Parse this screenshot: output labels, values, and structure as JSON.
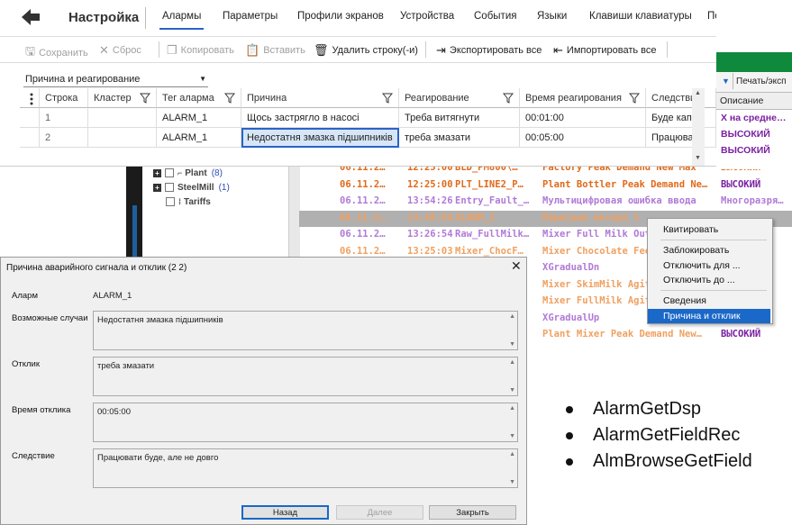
{
  "settings": {
    "title": "Настройка",
    "tabs": [
      "Алармы",
      "Параметры",
      "Профили экранов",
      "Устройства",
      "События",
      "Языки",
      "Клавиши клавиатуры",
      "Пс"
    ],
    "active_tab": 0,
    "toolbar": {
      "save": "Сохранить",
      "reset": "Сброс",
      "copy": "Копировать",
      "paste": "Вставить",
      "delete_row": "Удалить строку(-и)",
      "export_all": "Экспортировать все",
      "import_all": "Импортировать все"
    },
    "filter_label": "Причина и реагирование",
    "grid": {
      "headers": [
        "Строка",
        "Кластер",
        "Тег аларма",
        "Причина",
        "Реагирование",
        "Время реагирования",
        "Следстви"
      ],
      "rows": [
        {
          "row": "1",
          "cluster": "",
          "tag": "ALARM_1",
          "cause": "Щось застрягло в насосі",
          "response": "Треба витягнути",
          "time": "00:01:00",
          "effect": "Буде капе"
        },
        {
          "row": "2",
          "cluster": "",
          "tag": "ALARM_1",
          "cause": "Недостатня змазка підшипників",
          "response": "треба змазати",
          "time": "00:05:00",
          "effect": "Працюват"
        }
      ]
    }
  },
  "alarm_list": {
    "tree": [
      {
        "label": "Plant",
        "count": "(8)"
      },
      {
        "label": "SteelMill",
        "count": "(1)"
      },
      {
        "label": "Tariffs",
        "count": ""
      }
    ],
    "print_label": "Печать/эксп",
    "desc_header": "Описание",
    "right_cells": [
      {
        "text": "Х на средне…",
        "color": "#7a1fa2"
      },
      {
        "text": "ВЫСОКИЙ",
        "color": "#7a1fa2"
      },
      {
        "text": "ВЫСОКИЙ",
        "color": "#7a1fa2"
      }
    ],
    "rows": [
      {
        "date": "06.11.2…",
        "time": "12:25:00",
        "tag": "BLD_PM800\\…",
        "desc": "Factory Peak Demand New Max",
        "prio": "ВЫСОКИЙ",
        "color": "#e06a1a"
      },
      {
        "date": "06.11.2…",
        "time": "12:25:00",
        "tag": "PLT_LINE2_P…",
        "desc": "Plant Bottler Peak Demand Ne…",
        "prio": "ВЫСОКИЙ",
        "color": "#e06a1a"
      },
      {
        "date": "06.11.2…",
        "time": "13:54:26",
        "tag": "Entry_Fault_…",
        "desc": "Мультицифровая ошибка ввода",
        "prio": "Многоразря…",
        "color": "#b07ad6"
      },
      {
        "date": "06.11.2…",
        "time": "13:49:54",
        "tag": "ALARM_1",
        "desc": "Перегрев мотора 1",
        "prio": "",
        "color": "#f0a060"
      },
      {
        "date": "06.11.2…",
        "time": "13:26:54",
        "tag": "Raw_FullMilk…",
        "desc": "Mixer Full Milk Out P…",
        "prio": "",
        "color": "#b07ad6"
      },
      {
        "date": "06.11.2…",
        "time": "13:25:03",
        "tag": "Mixer_ChocF…",
        "desc": "Mixer Chocolate Feed",
        "prio": "",
        "color": "#f0a060"
      },
      {
        "date": "",
        "time": "",
        "tag": "",
        "desc": "XGradualDn",
        "prio": "",
        "color": "#b07ad6"
      },
      {
        "date": "",
        "time": "",
        "tag": "",
        "desc": "Mixer SkimMilk Agitat",
        "prio": "",
        "color": "#f0a060"
      },
      {
        "date": "",
        "time": "",
        "tag": "",
        "desc": "Mixer FullMilk Agitato",
        "prio": "",
        "color": "#f0a060"
      },
      {
        "date": "",
        "time": "",
        "tag": "",
        "desc": "XGradualUp",
        "prio": "",
        "color": "#b07ad6"
      },
      {
        "date": "",
        "time": "",
        "tag": "",
        "desc": "Plant Mixer Peak Demand New…",
        "prio": "ВЫСОКИЙ",
        "color": "#f0a060"
      }
    ]
  },
  "context_menu": {
    "items": [
      "Квитировать",
      "Заблокировать",
      "Отключить для ...",
      "Отключить до ...",
      "Сведения",
      "Причина и отклик"
    ],
    "highlighted": 5
  },
  "dialog": {
    "title": "Причина аварийного сигнала и отклик (2  2)",
    "alarm_label": "Аларм",
    "alarm_value": "ALARM_1",
    "cause_label": "Возможные случаи",
    "cause_value": "Недостатня змазка підшипників",
    "response_label": "Отклик",
    "response_value": "треба змазати",
    "time_label": "Время отклика",
    "time_value": "00:05:00",
    "effect_label": "Следствие",
    "effect_value": "Працювати буде, але не довго",
    "back": "Назад",
    "next": "Далее",
    "close": "Закрыть"
  },
  "bullets": [
    "AlarmGetDsp",
    "AlarmGetFieldRec",
    "AlmBrowseGetField"
  ]
}
